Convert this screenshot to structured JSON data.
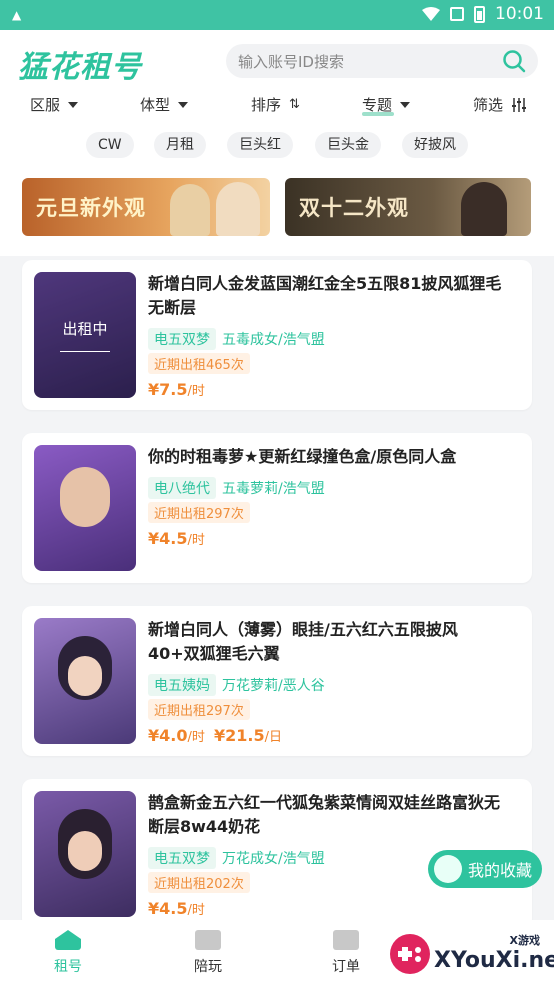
{
  "status_bar": {
    "time": "10:01"
  },
  "header": {
    "logo": "猛花租号",
    "search_placeholder": "输入账号ID搜索"
  },
  "filters": [
    {
      "label": "区服",
      "icon": "caret-down-icon"
    },
    {
      "label": "体型",
      "icon": "caret-down-icon"
    },
    {
      "label": "排序",
      "icon": "sort-icon"
    },
    {
      "label": "专题",
      "icon": "caret-down-icon",
      "active": true
    },
    {
      "label": "筛选",
      "icon": "filter-icon"
    }
  ],
  "tags": [
    "CW",
    "月租",
    "巨头红",
    "巨头金",
    "好披风"
  ],
  "banners": [
    {
      "text": "元旦新外观"
    },
    {
      "text": "双十二外观"
    }
  ],
  "listings": [
    {
      "badge": "出租中",
      "title": "新增白同人金发蓝国潮红金全5五限81披风狐狸毛无断层",
      "server": "电五双梦",
      "sect": "五毒成女/浩气盟",
      "rent_count": "近期出租465次",
      "price": "¥7.5",
      "price_unit": "/时"
    },
    {
      "title": "你的时租毒萝★更新红绿撞色盒/原色同人盒",
      "server": "电八绝代",
      "sect": "五毒萝莉/浩气盟",
      "rent_count": "近期出租297次",
      "price": "¥4.5",
      "price_unit": "/时"
    },
    {
      "title": "新增白同人（薄雾）眼挂/五六红六五限披风40+双狐狸毛六翼",
      "server": "电五姨妈",
      "sect": "万花萝莉/恶人谷",
      "rent_count": "近期出租297次",
      "price": "¥4.0",
      "price_unit": "/时",
      "price2": "¥21.5",
      "price2_unit": "/日"
    },
    {
      "title": "鹊盒新金五六红一代狐兔紫菜情阅双娃丝路富狄无断层8w44奶花",
      "server": "电五双梦",
      "sect": "万花成女/浩气盟",
      "rent_count": "近期出租202次",
      "price": "¥4.5",
      "price_unit": "/时"
    }
  ],
  "fav_button": "我的收藏",
  "bottom_nav": [
    {
      "label": "租号",
      "active": true
    },
    {
      "label": "陪玩"
    },
    {
      "label": "订单"
    }
  ],
  "watermark": {
    "small": "X游戏",
    "site": "XYouXi.net"
  },
  "colors": {
    "accent": "#2ec39e",
    "status_bar": "#3fc3a4",
    "price": "#f0832a"
  }
}
